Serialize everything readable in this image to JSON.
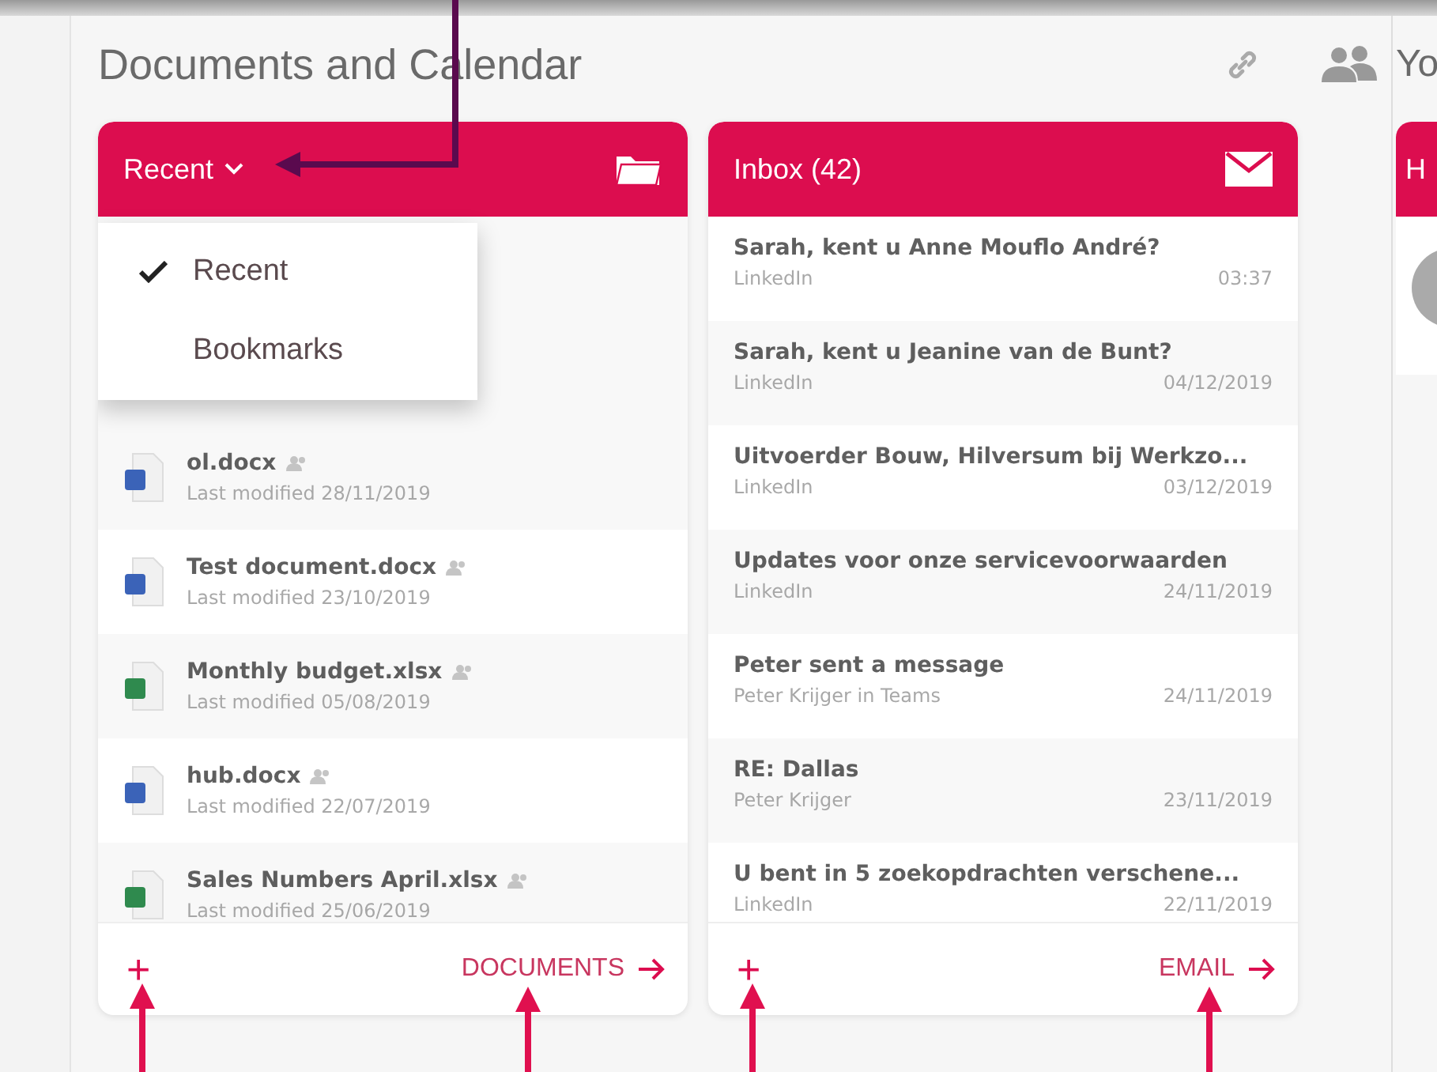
{
  "section_title": "Documents and Calendar",
  "next_section_title": "Yo",
  "documents": {
    "header": {
      "label": "Recent"
    },
    "dropdown": [
      {
        "label": "Recent",
        "selected": true
      },
      {
        "label": "Bookmarks",
        "selected": false
      }
    ],
    "items": [
      {
        "name": "ol.docx",
        "modified": "Last modified 28/11/2019",
        "kind": "word"
      },
      {
        "name": "Test document.docx",
        "modified": "Last modified 23/10/2019",
        "kind": "word"
      },
      {
        "name": "Monthly budget.xlsx",
        "modified": "Last modified 05/08/2019",
        "kind": "excel"
      },
      {
        "name": "hub.docx",
        "modified": "Last modified 22/07/2019",
        "kind": "word"
      },
      {
        "name": "Sales Numbers April.xlsx",
        "modified": "Last modified 25/06/2019",
        "kind": "excel"
      }
    ],
    "footer": {
      "add": "+",
      "link": "DOCUMENTS"
    }
  },
  "inbox": {
    "title": "Inbox (42)",
    "messages": [
      {
        "subject": "Sarah, kent u Anne Mouflo André?",
        "sender": "LinkedIn",
        "time": "03:37"
      },
      {
        "subject": "Sarah, kent u Jeanine van de Bunt?",
        "sender": "LinkedIn",
        "time": "04/12/2019"
      },
      {
        "subject": "Uitvoerder Bouw, Hilversum bij Werkzo...",
        "sender": "LinkedIn",
        "time": "03/12/2019"
      },
      {
        "subject": "Updates voor onze servicevoorwaarden",
        "sender": "LinkedIn",
        "time": "24/11/2019"
      },
      {
        "subject": "Peter sent a message",
        "sender": "Peter Krijger in Teams",
        "time": "24/11/2019"
      },
      {
        "subject": "RE: Dallas",
        "sender": "Peter Krijger",
        "time": "23/11/2019"
      },
      {
        "subject": "U bent in 5 zoekopdrachten verschene...",
        "sender": "LinkedIn",
        "time": "22/11/2019"
      }
    ],
    "footer": {
      "add": "+",
      "link": "EMAIL"
    }
  },
  "third_card": {
    "title": "H"
  }
}
